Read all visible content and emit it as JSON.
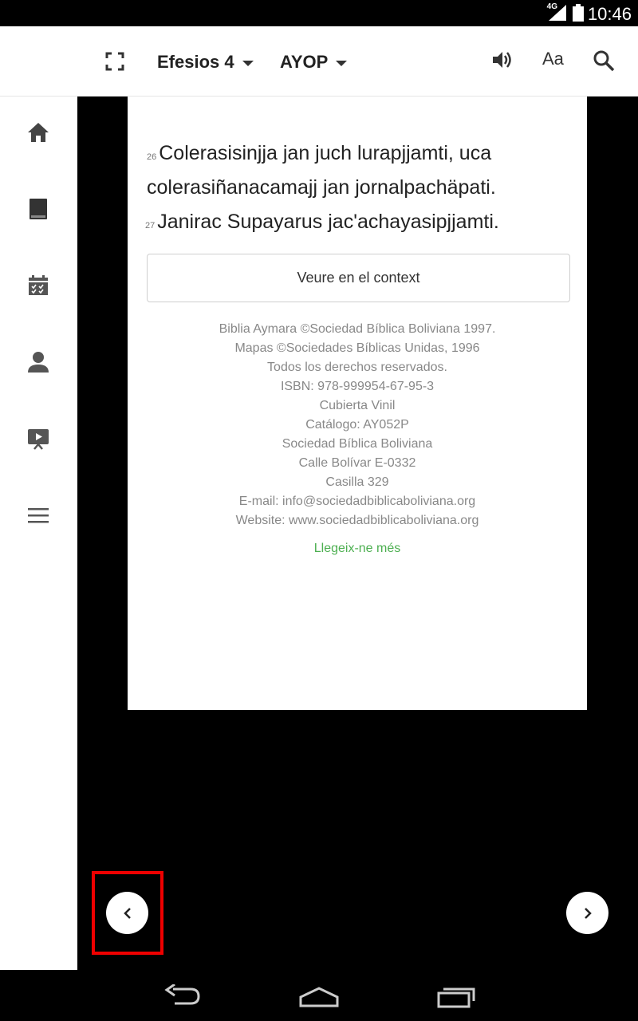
{
  "status_bar": {
    "time": "10:46",
    "network": "4G"
  },
  "toolbar": {
    "book": "Efesios 4",
    "version": "AYOP",
    "font_label": "Aa"
  },
  "verses": [
    {
      "num": "26",
      "line1": "Colerasisinjja jan juch lurapjjamti, uca",
      "line2": "colerasiñanacamajj jan jornalpachäpati."
    },
    {
      "num": "27",
      "line1": "Janirac Supayarus jac'achayasipjjamti."
    }
  ],
  "context_button": "Veure en el context",
  "copyright_lines": [
    "Biblia Aymara ©Sociedad Bíblica Boliviana 1997.",
    "Mapas ©Sociedades Bíblicas Unidas, 1996",
    "Todos los derechos reservados.",
    "ISBN: 978-999954-67-95-3",
    "Cubierta Vinil",
    "Catálogo: AY052P",
    "Sociedad Bíblica Boliviana",
    "Calle Bolívar E-0332",
    "Casilla 329",
    "E-mail: info@sociedadbiblicaboliviana.org",
    "Website: www.sociedadbiblicaboliviana.org"
  ],
  "read_more": "Llegeix-ne més",
  "colors": {
    "accent_green": "#4caf50",
    "highlight_red": "#e00000"
  },
  "icons": {
    "sidebar": [
      "home-icon",
      "book-icon",
      "plan-icon",
      "person-icon",
      "video-icon",
      "menu-icon"
    ],
    "toolbar": [
      "fullscreen-icon",
      "volume-icon",
      "search-icon"
    ],
    "navbar": [
      "back-icon",
      "home-icon",
      "recents-icon"
    ]
  }
}
